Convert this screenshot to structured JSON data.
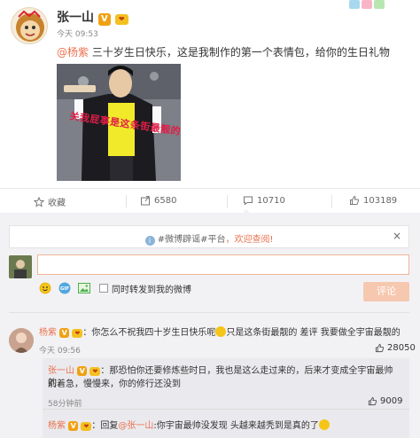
{
  "post": {
    "author": "张一山",
    "verified_badge": "V",
    "time": "今天 09:53",
    "mention": "@杨紫",
    "text": " 三十岁生日快乐，这是我制作的第一个表情包，给你的生日礼物",
    "image_caption": "关我屁事是这条街最靓的仔"
  },
  "actions": {
    "favorite": "收藏",
    "repost": "6580",
    "comment": "10710",
    "like": "103189"
  },
  "notice": {
    "topic": "#微博辟谣#平台",
    "suffix": "，欢迎查阅!",
    "close": "×"
  },
  "composer": {
    "repost_label": "同时转发到我的微博",
    "submit": "评论"
  },
  "comments": [
    {
      "name": "杨紫",
      "colon": "：",
      "text_before": "你怎么不祝我四十岁生日快乐呢",
      "text_after": "只是这条街最靓的 差评 我要做全宇宙最靓的",
      "time": "今天 09:56",
      "likes": "28050"
    }
  ],
  "replies": [
    {
      "name": "张一山",
      "line1": "：那恐怕你还要修炼些时日，我也是这么走过来的，后来才变成全宇宙最帅的，",
      "line2": "别着急，慢慢来，你的修行还没到",
      "likes": "9009"
    },
    {
      "name": "杨紫",
      "prefix": "：回复",
      "mention": "@张一山",
      "text": ":你宇宙最帅没发现 头越来越秃到是真的了"
    }
  ],
  "more_replies": "58分钟前",
  "colors": {
    "accent": "#eb7350",
    "verified": "#f0a113",
    "background": "#f2f2f5"
  }
}
